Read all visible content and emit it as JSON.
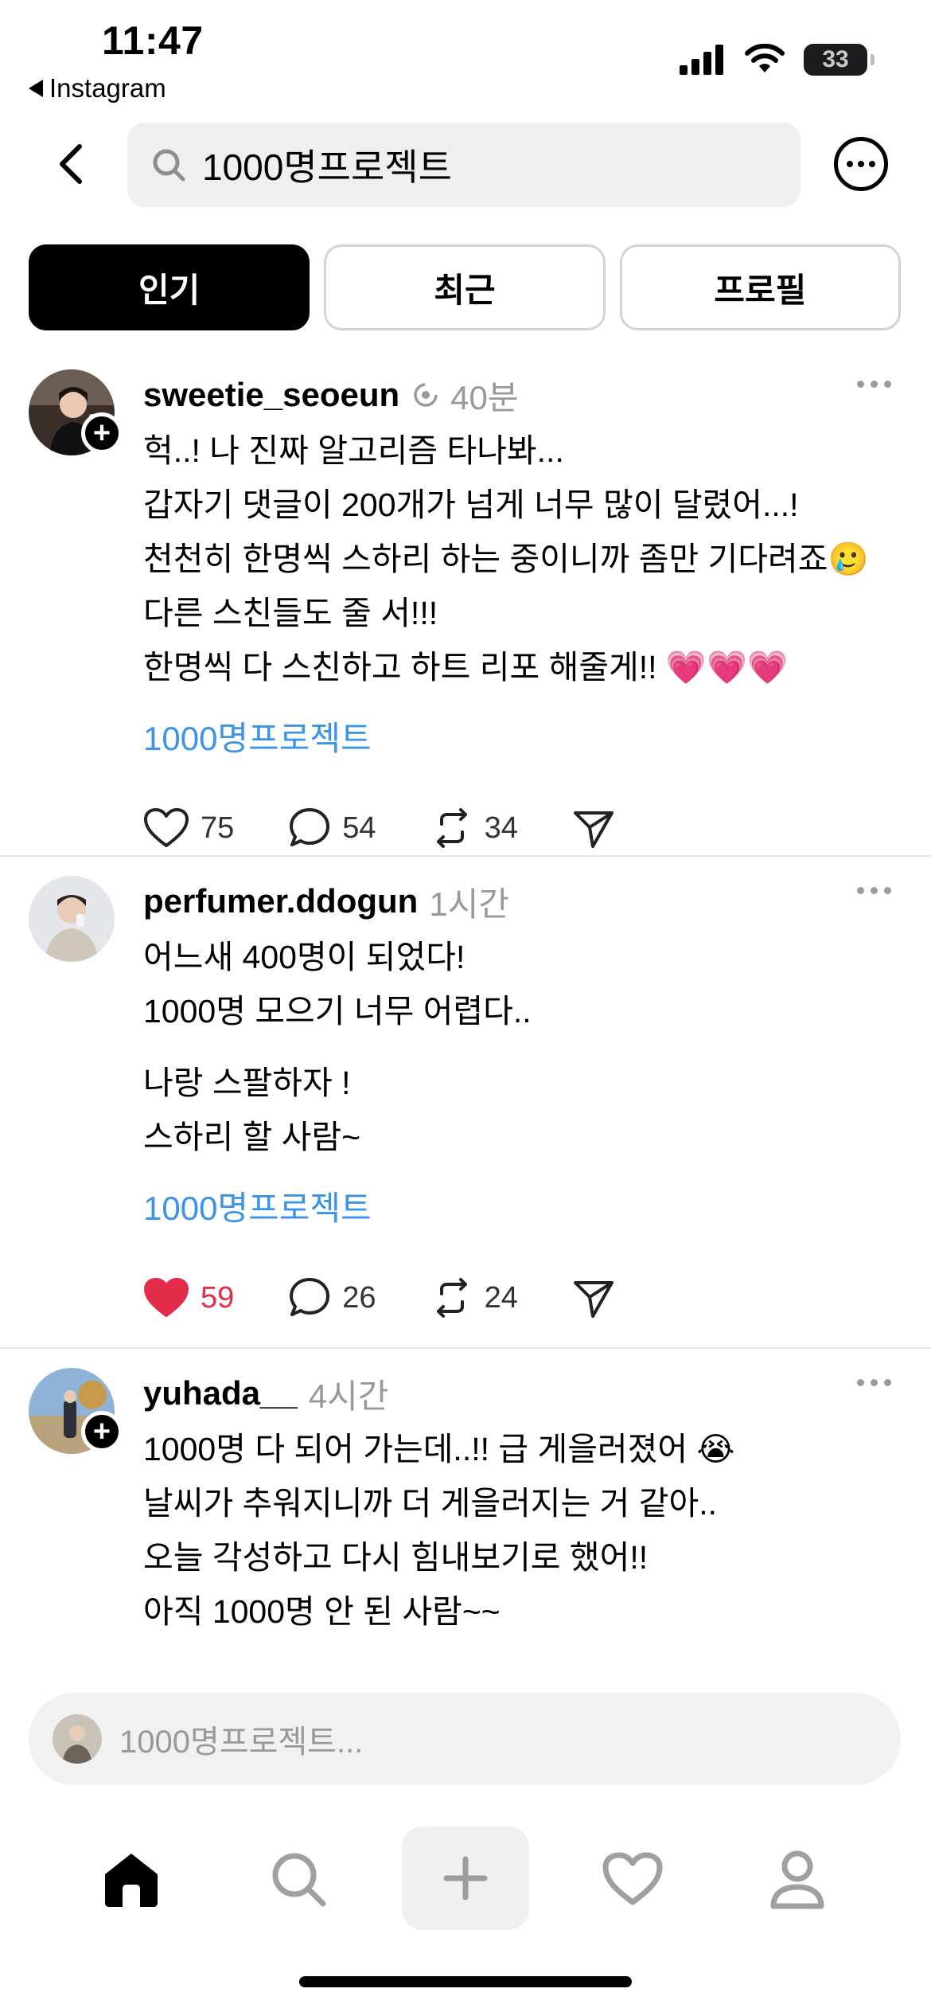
{
  "status_bar": {
    "time": "11:47",
    "back_app": "Instagram",
    "battery": "33"
  },
  "search": {
    "query": "1000명프로젝트"
  },
  "tabs": [
    {
      "label": "인기",
      "active": true
    },
    {
      "label": "최근",
      "active": false
    },
    {
      "label": "프로필",
      "active": false
    }
  ],
  "posts": [
    {
      "username": "sweetie_seoeun",
      "time": "40분",
      "lines": [
        "헉..! 나 진짜 알고리즘 타나봐...",
        "갑자기 댓글이 200개가 넘게 너무 많이 달렸어...!",
        "천천히 한명씩 스하리 하는 중이니까 좀만 기다려죠🥲",
        "다른 스친들도 줄 서!!!",
        "한명씩 다 스친하고 하트 리포 해줄게!! 💗💗💗"
      ],
      "hashtag": "1000명프로젝트",
      "likes": "75",
      "comments": "54",
      "reposts": "34",
      "liked": false
    },
    {
      "username": "perfumer.ddogun",
      "time": "1시간",
      "lines": [
        "어느새 400명이 되었다!",
        "1000명 모으기 너무 어렵다.."
      ],
      "lines2": [
        "나랑 스팔하자 !",
        "스하리 할 사람~"
      ],
      "hashtag": "1000명프로젝트",
      "likes": "59",
      "comments": "26",
      "reposts": "24",
      "liked": true
    },
    {
      "username": "yuhada__",
      "time": "4시간",
      "lines": [
        "1000명 다 되어 가는데..!! 급 게을러졌어 😭",
        "날씨가 추워지니까 더 게을러지는 거 같아..",
        "오늘 각성하고 다시 힘내보기로 했어!!",
        "아직 1000명 안 된 사람~~"
      ]
    }
  ],
  "composer": {
    "placeholder": "1000명프로젝트..."
  },
  "colors": {
    "link": "#3b94e6",
    "like": "#e32c49",
    "muted": "#999999"
  }
}
